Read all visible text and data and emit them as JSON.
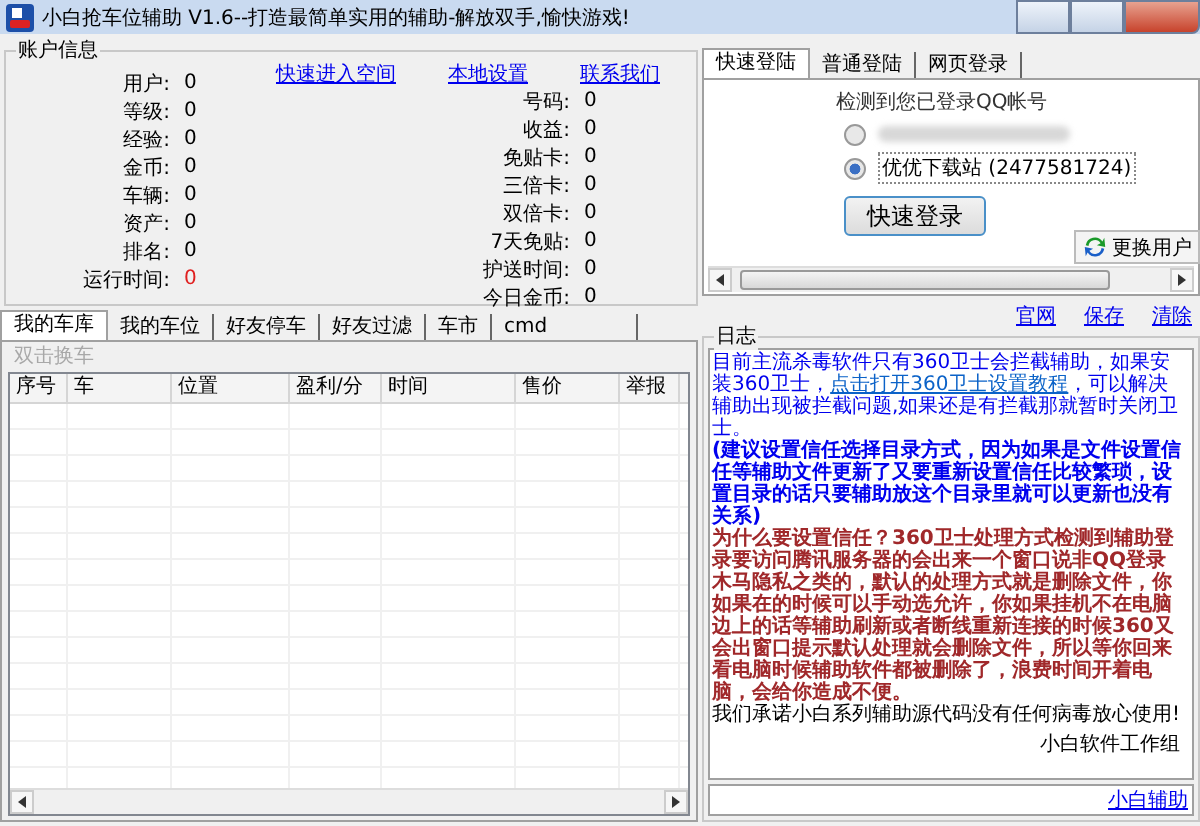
{
  "window": {
    "title": "小白抢车位辅助 V1.6--打造最简单实用的辅助-解放双手,愉快游戏!"
  },
  "account": {
    "title": "账户信息",
    "links": [
      "快速进入空间",
      "本地设置",
      "联系我们"
    ],
    "left_fields": [
      {
        "label": "用户:",
        "value": "0",
        "alert": false
      },
      {
        "label": "等级:",
        "value": "0",
        "alert": false
      },
      {
        "label": "经验:",
        "value": "0",
        "alert": false
      },
      {
        "label": "金币:",
        "value": "0",
        "alert": false
      },
      {
        "label": "车辆:",
        "value": "0",
        "alert": false
      },
      {
        "label": "资产:",
        "value": "0",
        "alert": false
      },
      {
        "label": "排名:",
        "value": "0",
        "alert": false
      },
      {
        "label": "运行时间:",
        "value": "0",
        "alert": true
      }
    ],
    "right_fields": [
      {
        "label": "号码:",
        "value": "0",
        "alert": false
      },
      {
        "label": "收益:",
        "value": "0",
        "alert": false
      },
      {
        "label": "免贴卡:",
        "value": "0",
        "alert": false
      },
      {
        "label": "三倍卡:",
        "value": "0",
        "alert": false
      },
      {
        "label": "双倍卡:",
        "value": "0",
        "alert": false
      },
      {
        "label": "7天免贴:",
        "value": "0",
        "alert": false
      },
      {
        "label": "护送时间:",
        "value": "0",
        "alert": false
      },
      {
        "label": "今日金币:",
        "value": "0",
        "alert": false
      }
    ]
  },
  "main_tabs": [
    {
      "label": "我的车库",
      "selected": true
    },
    {
      "label": "我的车位",
      "selected": false
    },
    {
      "label": "好友停车",
      "selected": false
    },
    {
      "label": "好友过滤",
      "selected": false
    },
    {
      "label": "车市",
      "selected": false
    },
    {
      "label": "cmd",
      "selected": false
    }
  ],
  "garage": {
    "hint": "双击换车",
    "columns": [
      "序号",
      "车",
      "位置",
      "盈利/分",
      "时间",
      "售价",
      "举报"
    ]
  },
  "login_tabs": [
    {
      "label": "快速登陆",
      "selected": true
    },
    {
      "label": "普通登陆",
      "selected": false
    },
    {
      "label": "网页登录",
      "selected": false
    }
  ],
  "quick_login": {
    "heading": "检测到您已登录QQ帐号",
    "accounts": [
      {
        "selected": false,
        "blurred": true
      },
      {
        "label": "优优下载站 (2477581724)",
        "selected": true,
        "blurred": false
      }
    ],
    "login_button": "快速登录",
    "switch_button": "更换用户"
  },
  "log_links": [
    "官网",
    "保存",
    "清除"
  ],
  "log": {
    "title": "日志",
    "entries": [
      {
        "kind": "notice",
        "segments": [
          {
            "text": "目前主流杀毒软件只有360卫士会拦截辅助，如果安装360卫士，",
            "link": false
          },
          {
            "text": "点击打开360卫士设置教程",
            "link": true
          },
          {
            "text": "，可以解决辅助出现被拦截问题,如果还是有拦截那就暂时关闭卫士。",
            "link": false
          }
        ]
      },
      {
        "kind": "advice",
        "segments": [
          {
            "text": "(建议设置信任选择目录方式，因为如果是文件设置信任等辅助文件更新了又要重新设置信任比较繁琐，设置目录的话只要辅助放这个目录里就可以更新也没有关系)",
            "link": false
          }
        ]
      },
      {
        "kind": "warning",
        "segments": [
          {
            "text": "为什么要设置信任？360卫士处理方式检测到辅助登录要访问腾讯服务器的会出来一个窗口说非QQ登录木马隐私之类的，默认的处理方式就是删除文件，你如果在的时候可以手动选允许，你如果挂机不在电脑边上的话等辅助刷新或者断线重新连接的时候360又会出窗口提示默认处理就会删除文件，所以等你回来看电脑时候辅助软件都被删除了，浪费时间开着电脑，会给你造成不便。",
            "link": false
          }
        ]
      },
      {
        "kind": "plain",
        "segments": [
          {
            "text": "我们承诺小白系列辅助源代码没有任何病毒放心使用!",
            "link": false
          }
        ]
      },
      {
        "kind": "signature",
        "segments": [
          {
            "text": "小白软件工作组",
            "link": false
          }
        ]
      }
    ],
    "footer_link": "小白辅助"
  }
}
